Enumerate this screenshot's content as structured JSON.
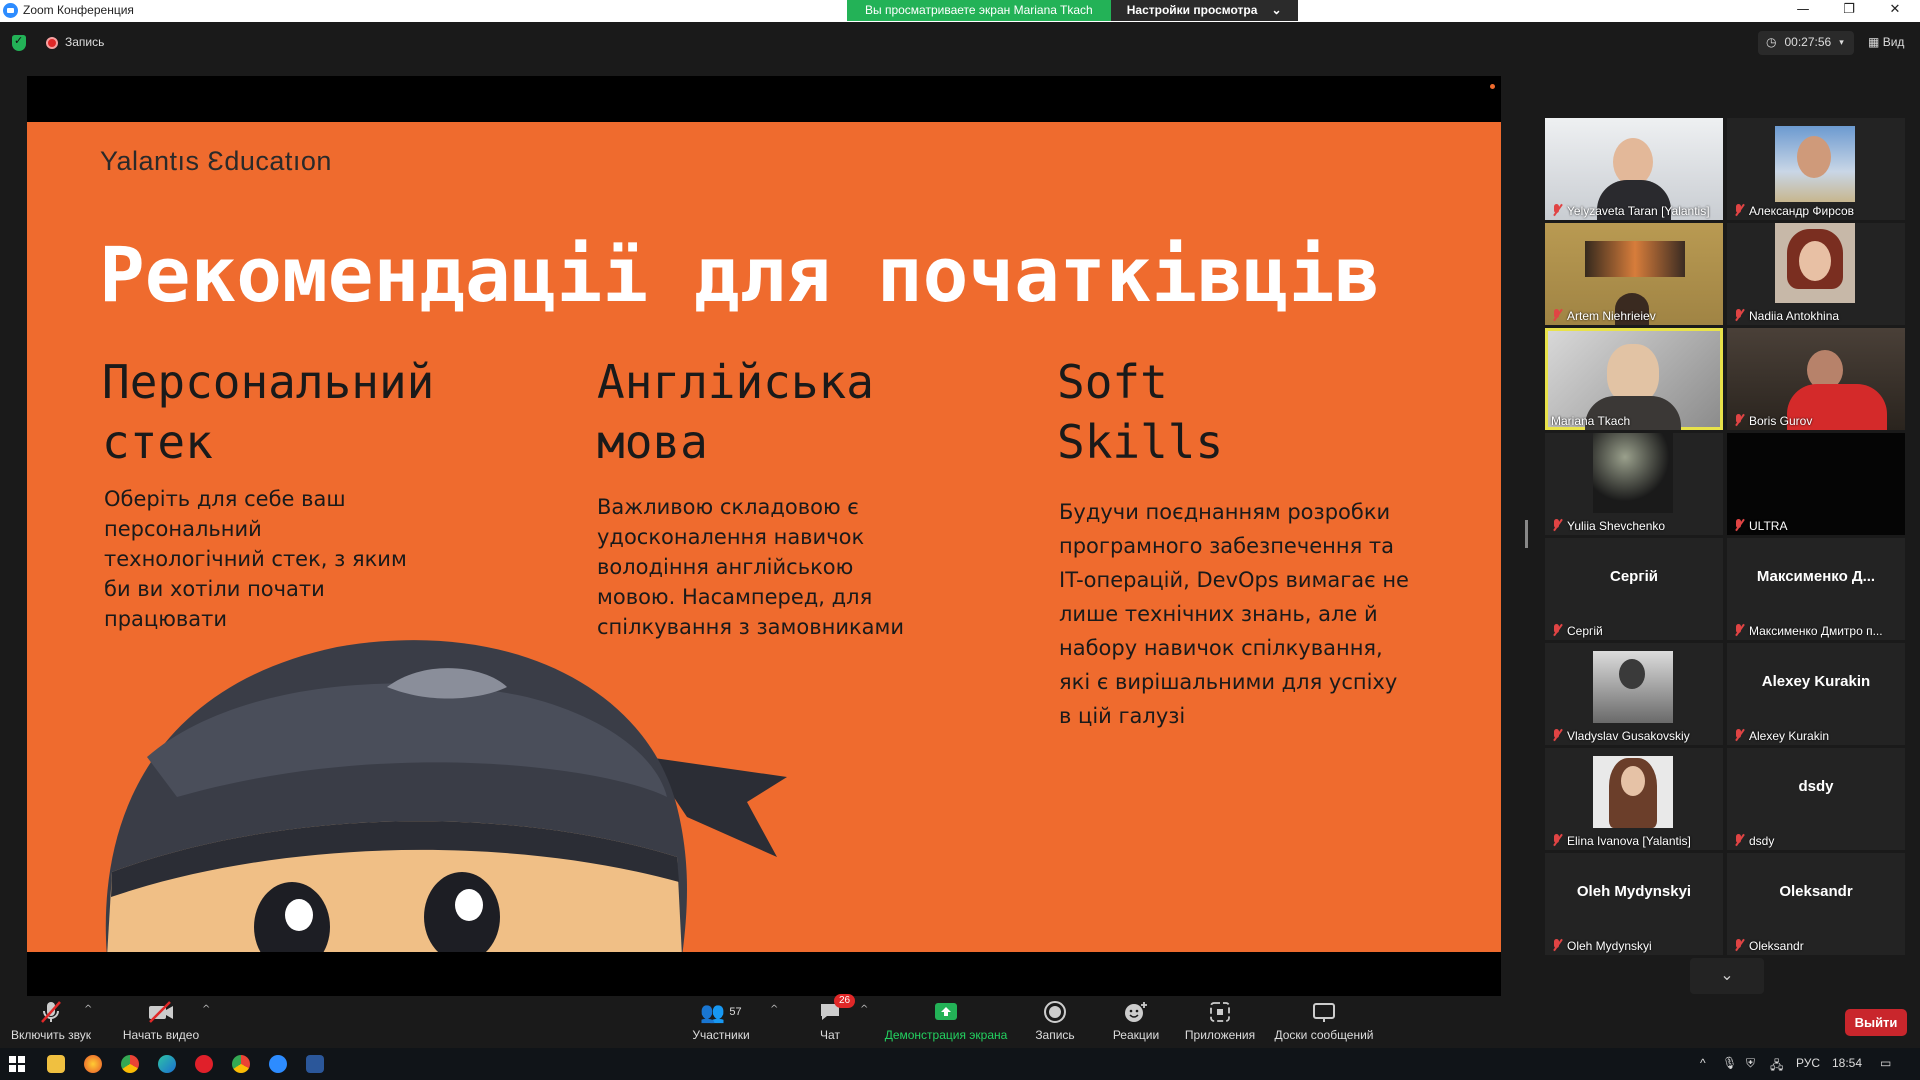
{
  "window": {
    "title": "Zoom Конференция",
    "banner_viewing": "Вы просматриваете экран Mariana Tkach",
    "banner_settings": "Настройки просмотра",
    "btn_minimize": "—",
    "btn_restore": "❐",
    "btn_close": "✕"
  },
  "topbar": {
    "recording_label": "Запись",
    "timer": "00:27:56",
    "view_label": "Вид"
  },
  "slide": {
    "logo": "Yalantıs Ɛducatıon",
    "title": "Рекомендації для початківців",
    "columns": [
      {
        "head1": "Персональний",
        "head2": "стек",
        "body": [
          "Оберіть для себе ваш",
          "персональний",
          "технологічний стек, з яким",
          "би ви хотіли почати",
          "працювати"
        ]
      },
      {
        "head1": "Англійська",
        "head2": "мова",
        "body": [
          "Важливою складовою є",
          "удосконалення навичок",
          "володіння англійською",
          "мовою. Насамперед, для",
          "спілкування з замовниками"
        ]
      },
      {
        "head1": "Soft",
        "head2": "Skills",
        "body": [
          "Будучи поєднанням розробки",
          "програмного забезпечення та",
          "IT-операцій, DevOps вимагає не",
          "лише технічних знань, але й",
          "набору навичок спілкування,",
          "які є вирішальними для успіху",
          "в цій галузі"
        ]
      }
    ]
  },
  "participants": [
    {
      "name": "Yelyzaveta Taran [Yalantis]",
      "big": ""
    },
    {
      "name": "Александр Фирсов",
      "big": ""
    },
    {
      "name": "Artem Niehrieiev",
      "big": ""
    },
    {
      "name": "Nadiia Antokhina",
      "big": ""
    },
    {
      "name": "Mariana Tkach",
      "big": ""
    },
    {
      "name": "Boris Gurov",
      "big": ""
    },
    {
      "name": "Yuliia Shevchenko",
      "big": ""
    },
    {
      "name": "ULTRA",
      "big": ""
    },
    {
      "name": "Сергій",
      "big": "Сергій"
    },
    {
      "name": "Максименко Дмитро п...",
      "big": "Максименко Д..."
    },
    {
      "name": "Vladyslav Gusakovskiy",
      "big": ""
    },
    {
      "name": "Alexey Kurakin",
      "big": "Alexey Kurakin"
    },
    {
      "name": "Elina Ivanova [Yalantis]",
      "big": ""
    },
    {
      "name": "dsdy",
      "big": "dsdy"
    },
    {
      "name": "Oleh Mydynskyi",
      "big": "Oleh Mydynskyi"
    },
    {
      "name": "Oleksandr",
      "big": "Oleksandr"
    }
  ],
  "toolbar": {
    "unmute": "Включить звук",
    "start_video": "Начать видео",
    "participants": "Участники",
    "participants_count": "57",
    "chat": "Чат",
    "chat_badge": "26",
    "share": "Демонстрация экрана",
    "record": "Запись",
    "reactions": "Реакции",
    "apps": "Приложения",
    "whiteboards": "Доски сообщений",
    "exit": "Выйти"
  },
  "taskbar": {
    "lang": "РУС",
    "time": "18:54"
  },
  "colors": {
    "slide_bg": "#ef6b2e",
    "green": "#23b257",
    "exit_red": "#c9262c",
    "active_speaker": "#e8e24a"
  }
}
